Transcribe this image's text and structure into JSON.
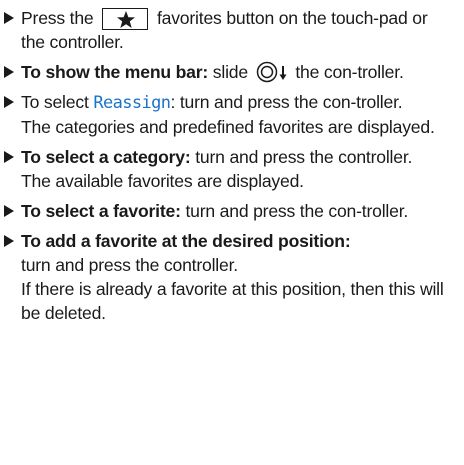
{
  "steps": [
    {
      "before": "Press the",
      "icon": "star-icon",
      "after": "favorites button on the touch-pad or the controller."
    },
    {
      "bold": "To show the menu bar:",
      "before": "slide",
      "icon": "controller-slide-down-icon",
      "after": "the con-troller."
    },
    {
      "before": "To select",
      "display_text": "Reassign",
      "after": ": turn and press the con-troller.",
      "result": "The categories and predefined favorites are displayed."
    },
    {
      "bold": "To select a category:",
      "after": "turn and press the controller.",
      "result": "The available favorites are displayed."
    },
    {
      "bold": "To select a favorite:",
      "after": "turn and press the con-troller."
    },
    {
      "bold": "To add a favorite at the desired position:",
      "after": "turn and press the controller.",
      "result": "If there is already a favorite at this position, then this will be deleted."
    }
  ],
  "colors": {
    "display_text": "#1a73c8",
    "text": "#1a1a1a"
  }
}
